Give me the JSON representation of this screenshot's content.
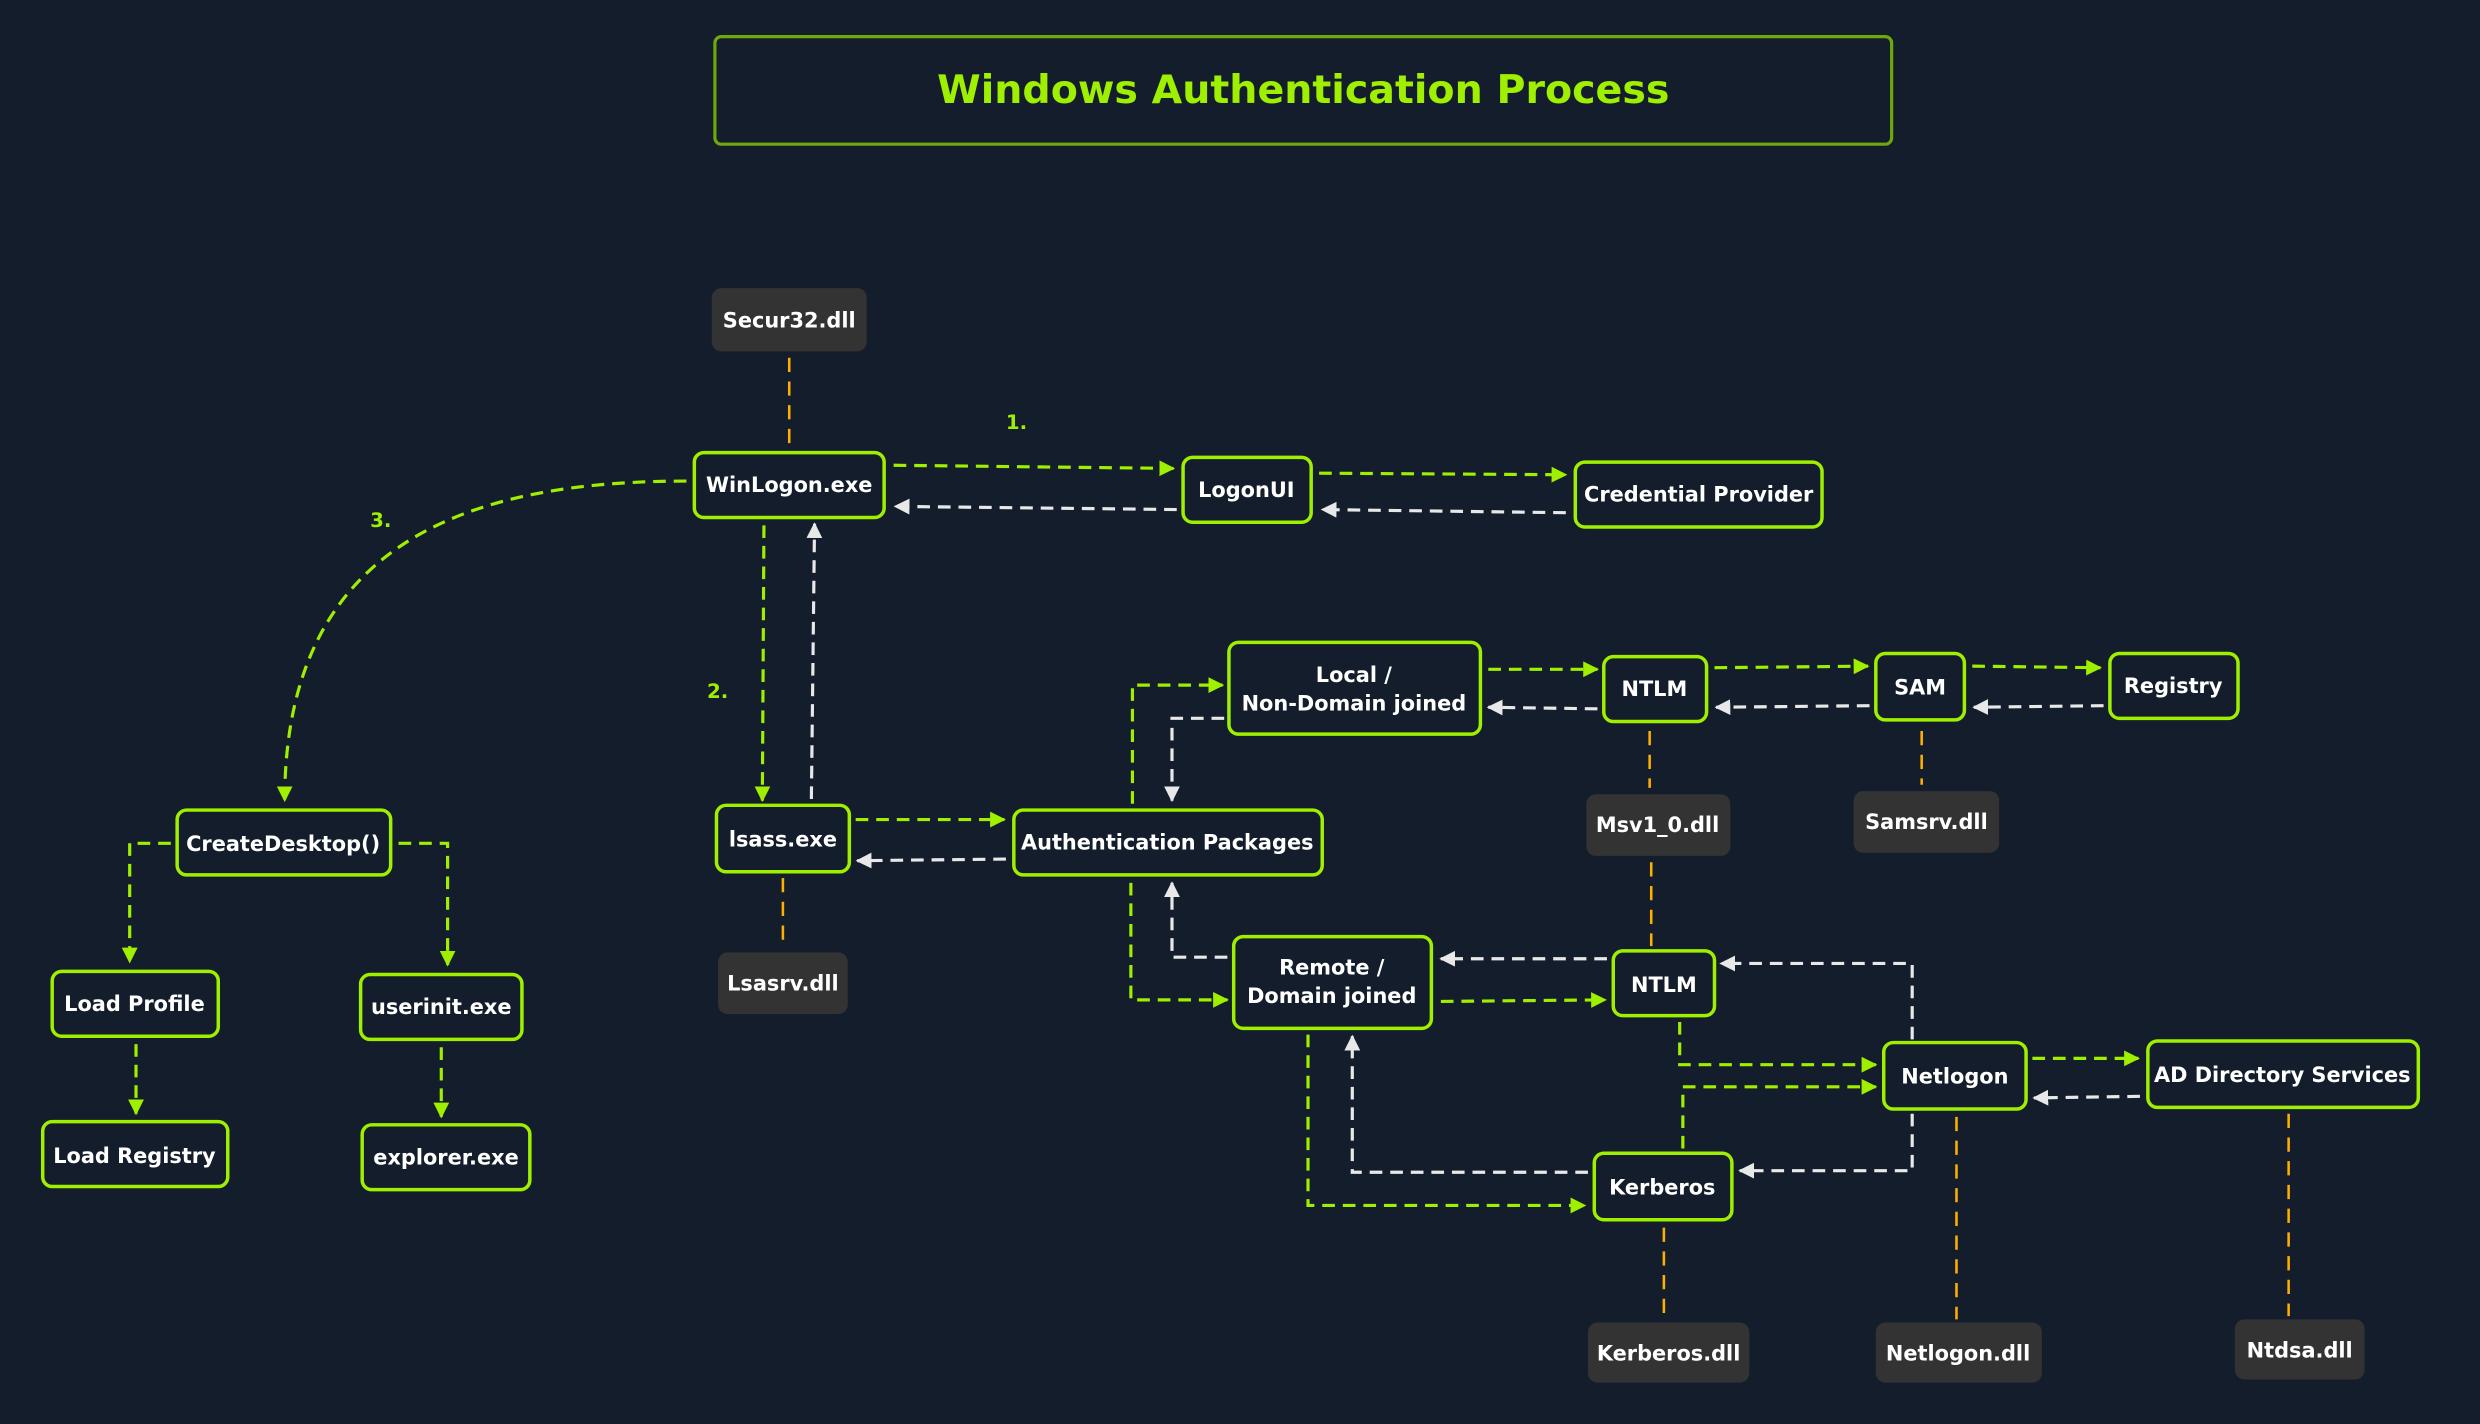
{
  "title": "Windows Authentication Process",
  "colors": {
    "background": "#141d2b",
    "accent": "#9fef00",
    "dll_box": "#333333",
    "dll_link": "#ffaf00",
    "return_arrow": "#e8e8e8",
    "text": "#ffffff"
  },
  "step_labels": {
    "step1": "1.",
    "step2": "2.",
    "step3": "3."
  },
  "nodes": {
    "winlogon": "WinLogon.exe",
    "logonui": "LogonUI",
    "credential_provider": "Credential Provider",
    "lsass": "lsass.exe",
    "auth_packages": "Authentication Packages",
    "local_line1": "Local /",
    "local_line2": "Non-Domain joined",
    "remote_line1": "Remote /",
    "remote_line2": "Domain joined",
    "ntlm_local": "NTLM",
    "sam": "SAM",
    "registry": "Registry",
    "ntlm_remote": "NTLM",
    "netlogon": "Netlogon",
    "ad_directory": "AD Directory Services",
    "kerberos": "Kerberos",
    "create_desktop": "CreateDesktop()",
    "load_profile": "Load Profile",
    "userinit": "userinit.exe",
    "load_registry": "Load Registry",
    "explorer": "explorer.exe"
  },
  "dlls": {
    "secur32": "Secur32.dll",
    "lsasrv": "Lsasrv.dll",
    "msv1_0": "Msv1_0.dll",
    "samsrv": "Samsrv.dll",
    "kerberos": "Kerberos.dll",
    "netlogon": "Netlogon.dll",
    "ntdsa": "Ntdsa.dll"
  },
  "edges": [
    {
      "from": "WinLogon.exe",
      "to": "LogonUI",
      "type": "call",
      "label": "1."
    },
    {
      "from": "LogonUI",
      "to": "WinLogon.exe",
      "type": "return"
    },
    {
      "from": "LogonUI",
      "to": "Credential Provider",
      "type": "call"
    },
    {
      "from": "Credential Provider",
      "to": "LogonUI",
      "type": "return"
    },
    {
      "from": "WinLogon.exe",
      "to": "lsass.exe",
      "type": "call",
      "label": "2."
    },
    {
      "from": "lsass.exe",
      "to": "WinLogon.exe",
      "type": "return"
    },
    {
      "from": "WinLogon.exe",
      "to": "CreateDesktop()",
      "type": "call",
      "label": "3."
    },
    {
      "from": "CreateDesktop()",
      "to": "Load Profile",
      "type": "call"
    },
    {
      "from": "CreateDesktop()",
      "to": "userinit.exe",
      "type": "call"
    },
    {
      "from": "Load Profile",
      "to": "Load Registry",
      "type": "call"
    },
    {
      "from": "userinit.exe",
      "to": "explorer.exe",
      "type": "call"
    },
    {
      "from": "lsass.exe",
      "to": "Authentication Packages",
      "type": "call"
    },
    {
      "from": "Authentication Packages",
      "to": "lsass.exe",
      "type": "return"
    },
    {
      "from": "Authentication Packages",
      "to": "Local / Non-Domain joined",
      "type": "call"
    },
    {
      "from": "Local / Non-Domain joined",
      "to": "Authentication Packages",
      "type": "return"
    },
    {
      "from": "Authentication Packages",
      "to": "Remote / Domain joined",
      "type": "call"
    },
    {
      "from": "Remote / Domain joined",
      "to": "Authentication Packages",
      "type": "return"
    },
    {
      "from": "Local / Non-Domain joined",
      "to": "NTLM (local)",
      "type": "call"
    },
    {
      "from": "NTLM (local)",
      "to": "Local / Non-Domain joined",
      "type": "return"
    },
    {
      "from": "NTLM (local)",
      "to": "SAM",
      "type": "call"
    },
    {
      "from": "SAM",
      "to": "NTLM (local)",
      "type": "return"
    },
    {
      "from": "SAM",
      "to": "Registry",
      "type": "call"
    },
    {
      "from": "Registry",
      "to": "SAM",
      "type": "return"
    },
    {
      "from": "Remote / Domain joined",
      "to": "NTLM (remote)",
      "type": "call"
    },
    {
      "from": "NTLM (remote)",
      "to": "Remote / Domain joined",
      "type": "return"
    },
    {
      "from": "Remote / Domain joined",
      "to": "Kerberos",
      "type": "call"
    },
    {
      "from": "Kerberos",
      "to": "Remote / Domain joined",
      "type": "return"
    },
    {
      "from": "NTLM (remote)",
      "to": "Netlogon",
      "type": "call"
    },
    {
      "from": "Netlogon",
      "to": "NTLM (remote)",
      "type": "return"
    },
    {
      "from": "Kerberos",
      "to": "Netlogon",
      "type": "call"
    },
    {
      "from": "Netlogon",
      "to": "Kerberos",
      "type": "return"
    },
    {
      "from": "Netlogon",
      "to": "AD Directory Services",
      "type": "call"
    },
    {
      "from": "AD Directory Services",
      "to": "Netlogon",
      "type": "return"
    },
    {
      "from": "Secur32.dll",
      "to": "WinLogon.exe",
      "type": "dll"
    },
    {
      "from": "Lsasrv.dll",
      "to": "lsass.exe",
      "type": "dll"
    },
    {
      "from": "Msv1_0.dll",
      "to": "NTLM",
      "type": "dll"
    },
    {
      "from": "Samsrv.dll",
      "to": "SAM",
      "type": "dll"
    },
    {
      "from": "Kerberos.dll",
      "to": "Kerberos",
      "type": "dll"
    },
    {
      "from": "Netlogon.dll",
      "to": "Netlogon",
      "type": "dll"
    },
    {
      "from": "Ntdsa.dll",
      "to": "AD Directory Services",
      "type": "dll"
    }
  ]
}
